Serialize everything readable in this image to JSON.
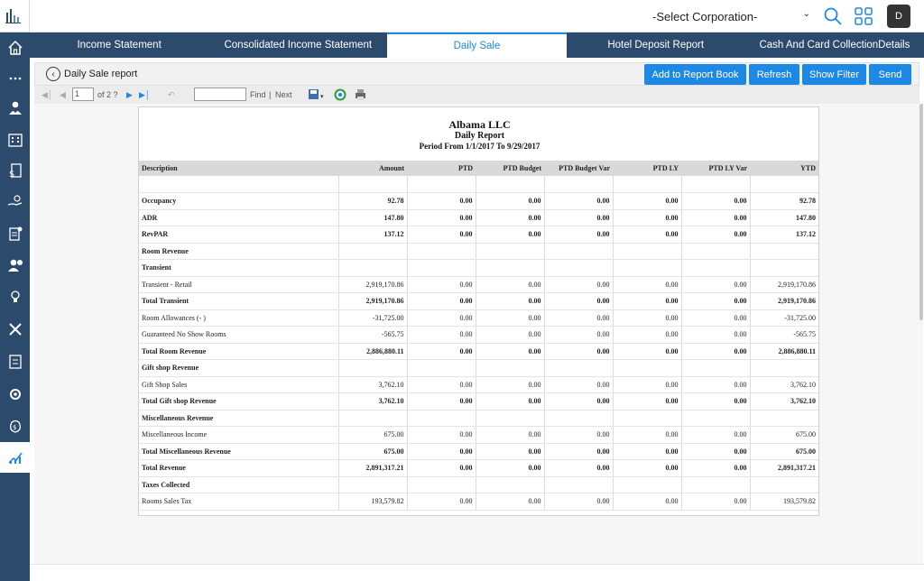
{
  "top_bar": {
    "corporation_select": "-Select Corporation-",
    "avatar_initial": "D"
  },
  "tabs": [
    {
      "label": "Income Statement"
    },
    {
      "label": "Consolidated Income Statement"
    },
    {
      "label": "Daily Sale"
    },
    {
      "label": "Hotel Deposit Report"
    },
    {
      "label": "Cash And Card CollectionDetails"
    }
  ],
  "report_bar": {
    "title": "Daily Sale report",
    "buttons": [
      "Add to Report Book",
      "Refresh",
      "Show Filter",
      "Send"
    ]
  },
  "viewer_toolbar": {
    "page": "1",
    "of_label": "of 2 ?",
    "find_label": "Find",
    "separator": "|",
    "next_label": "Next"
  },
  "report": {
    "company": "Albama LLC",
    "name": "Daily Report",
    "period": "Period From 1/1/2017 To 9/29/2017",
    "columns": [
      "Description",
      "Amount",
      "PTD",
      "PTD Budget",
      "PTD Budget Var",
      "PTD LY",
      "PTD LY Var",
      "YTD"
    ],
    "rows": [
      {
        "cells": [
          "",
          "",
          "",
          "",
          "",
          "",
          "",
          ""
        ],
        "bold": false
      },
      {
        "cells": [
          "Occupancy",
          "92.78",
          "0.00",
          "0.00",
          "0.00",
          "0.00",
          "0.00",
          "92.78"
        ],
        "bold": true
      },
      {
        "cells": [
          "ADR",
          "147.80",
          "0.00",
          "0.00",
          "0.00",
          "0.00",
          "0.00",
          "147.80"
        ],
        "bold": true
      },
      {
        "cells": [
          "RevPAR",
          "137.12",
          "0.00",
          "0.00",
          "0.00",
          "0.00",
          "0.00",
          "137.12"
        ],
        "bold": true
      },
      {
        "cells": [
          "Room Revenue",
          "",
          "",
          "",
          "",
          "",
          "",
          ""
        ],
        "bold": true
      },
      {
        "cells": [
          "Transient",
          "",
          "",
          "",
          "",
          "",
          "",
          ""
        ],
        "bold": true
      },
      {
        "cells": [
          "Transient - Retail",
          "2,919,170.86",
          "0.00",
          "0.00",
          "0.00",
          "0.00",
          "0.00",
          "2,919,170.86"
        ],
        "bold": false
      },
      {
        "cells": [
          "Total Transient",
          "2,919,170.86",
          "0.00",
          "0.00",
          "0.00",
          "0.00",
          "0.00",
          "2,919,170.86"
        ],
        "bold": true
      },
      {
        "cells": [
          "Room Allowances (- )",
          "-31,725.00",
          "0.00",
          "0.00",
          "0.00",
          "0.00",
          "0.00",
          "-31,725.00"
        ],
        "bold": false
      },
      {
        "cells": [
          "Guaranteed No Show Rooms",
          "-565.75",
          "0.00",
          "0.00",
          "0.00",
          "0.00",
          "0.00",
          "-565.75"
        ],
        "bold": false
      },
      {
        "cells": [
          "Total Room Revenue",
          "2,886,880.11",
          "0.00",
          "0.00",
          "0.00",
          "0.00",
          "0.00",
          "2,886,880.11"
        ],
        "bold": true
      },
      {
        "cells": [
          "Gift shop Revenue",
          "",
          "",
          "",
          "",
          "",
          "",
          ""
        ],
        "bold": true
      },
      {
        "cells": [
          "Gift Shop Sales",
          "3,762.10",
          "0.00",
          "0.00",
          "0.00",
          "0.00",
          "0.00",
          "3,762.10"
        ],
        "bold": false
      },
      {
        "cells": [
          "Total Gift shop Revenue",
          "3,762.10",
          "0.00",
          "0.00",
          "0.00",
          "0.00",
          "0.00",
          "3,762.10"
        ],
        "bold": true
      },
      {
        "cells": [
          "Miscellaneous Revenue",
          "",
          "",
          "",
          "",
          "",
          "",
          ""
        ],
        "bold": true
      },
      {
        "cells": [
          "Miscellaneous Income",
          "675.00",
          "0.00",
          "0.00",
          "0.00",
          "0.00",
          "0.00",
          "675.00"
        ],
        "bold": false
      },
      {
        "cells": [
          "Total Miscellaneous Revenue",
          "675.00",
          "0.00",
          "0.00",
          "0.00",
          "0.00",
          "0.00",
          "675.00"
        ],
        "bold": true
      },
      {
        "cells": [
          "Total Revenue",
          "2,891,317.21",
          "0.00",
          "0.00",
          "0.00",
          "0.00",
          "0.00",
          "2,891,317.21"
        ],
        "bold": true
      },
      {
        "cells": [
          "Taxes Collected",
          "",
          "",
          "",
          "",
          "",
          "",
          ""
        ],
        "bold": true
      },
      {
        "cells": [
          "Rooms Sales Tax",
          "193,579.82",
          "0.00",
          "0.00",
          "0.00",
          "0.00",
          "0.00",
          "193,579.82"
        ],
        "bold": false
      }
    ]
  },
  "colors": {
    "sidebar": "#2c4a6b",
    "accent": "#1e88e5"
  }
}
